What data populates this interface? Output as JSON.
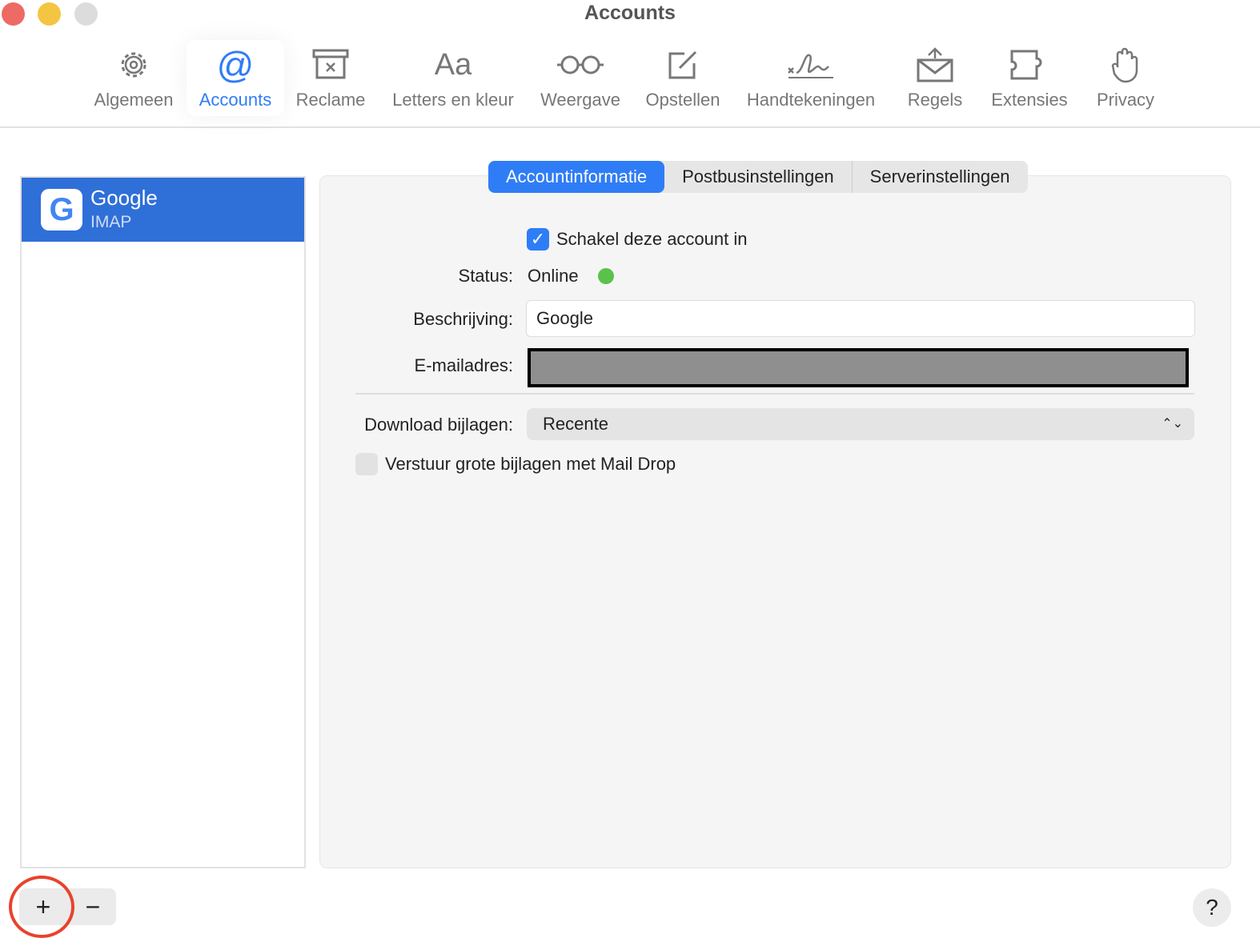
{
  "window": {
    "title": "Accounts"
  },
  "toolbar": [
    {
      "label": "Algemeen",
      "icon": "gear-icon"
    },
    {
      "label": "Accounts",
      "icon": "at-icon"
    },
    {
      "label": "Reclame",
      "icon": "junk-bin-icon"
    },
    {
      "label": "Letters en kleur",
      "icon": "font-icon"
    },
    {
      "label": "Weergave",
      "icon": "glasses-icon"
    },
    {
      "label": "Opstellen",
      "icon": "compose-icon"
    },
    {
      "label": "Handtekeningen",
      "icon": "signature-icon"
    },
    {
      "label": "Regels",
      "icon": "rules-envelope-icon"
    },
    {
      "label": "Extensies",
      "icon": "puzzle-icon"
    },
    {
      "label": "Privacy",
      "icon": "hand-icon"
    }
  ],
  "accounts": [
    {
      "name": "Google",
      "type": "IMAP",
      "logo": "G"
    }
  ],
  "tabs": [
    "Accountinformatie",
    "Postbusinstellingen",
    "Serverinstellingen"
  ],
  "form": {
    "enable_label": "Schakel deze account in",
    "status_label": "Status:",
    "status_value": "Online",
    "status_color": "#5ac24a",
    "description_label": "Beschrijving:",
    "description_value": "Google",
    "email_label": "E-mailadres:",
    "download_label": "Download bijlagen:",
    "download_value": "Recente",
    "maildrop_label": "Verstuur grote bijlagen met Mail Drop"
  },
  "footer": {
    "add": "+",
    "remove": "−",
    "help": "?"
  }
}
